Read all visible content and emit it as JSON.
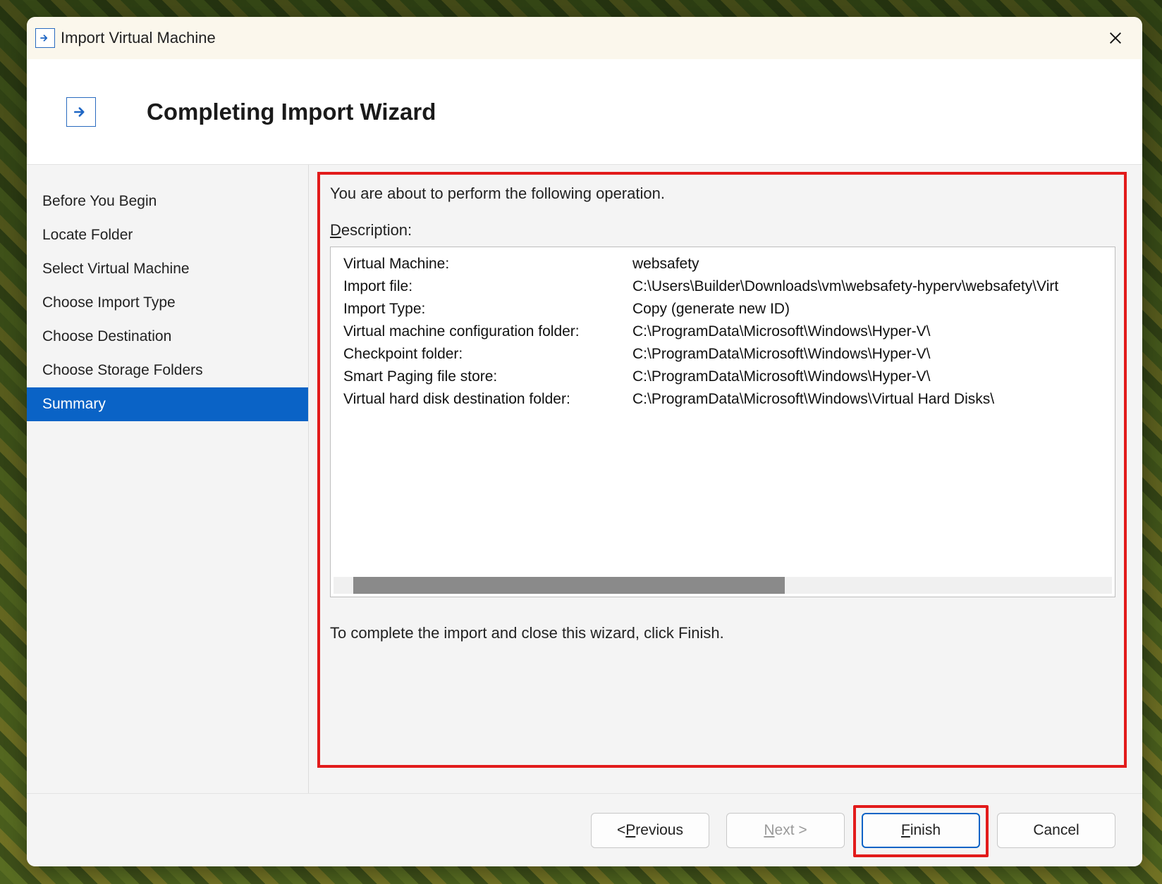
{
  "window": {
    "title": "Import Virtual Machine"
  },
  "header": {
    "heading": "Completing Import Wizard"
  },
  "sidebar": {
    "steps": [
      "Before You Begin",
      "Locate Folder",
      "Select Virtual Machine",
      "Choose Import Type",
      "Choose Destination",
      "Choose Storage Folders",
      "Summary"
    ],
    "selected_index": 6
  },
  "main": {
    "intro": "You are about to perform the following operation.",
    "description_label_prefix": "D",
    "description_label_rest": "escription:",
    "rows": [
      {
        "label": "Virtual Machine:",
        "value": "websafety"
      },
      {
        "label": "Import file:",
        "value": "C:\\Users\\Builder\\Downloads\\vm\\websafety-hyperv\\websafety\\Virt"
      },
      {
        "label": "Import Type:",
        "value": "Copy (generate new ID)"
      },
      {
        "label": "Virtual machine configuration folder:",
        "value": "C:\\ProgramData\\Microsoft\\Windows\\Hyper-V\\"
      },
      {
        "label": "Checkpoint folder:",
        "value": "C:\\ProgramData\\Microsoft\\Windows\\Hyper-V\\"
      },
      {
        "label": "Smart Paging file store:",
        "value": "C:\\ProgramData\\Microsoft\\Windows\\Hyper-V\\"
      },
      {
        "label": "Virtual hard disk destination folder:",
        "value": "C:\\ProgramData\\Microsoft\\Windows\\Virtual Hard Disks\\"
      }
    ],
    "closing": "To complete the import and close this wizard, click Finish."
  },
  "footer": {
    "previous_prefix": "< ",
    "previous_ul": "P",
    "previous_rest": "revious",
    "next_ul": "N",
    "next_rest": "ext >",
    "finish_ul": "F",
    "finish_rest": "inish",
    "cancel": "Cancel"
  }
}
